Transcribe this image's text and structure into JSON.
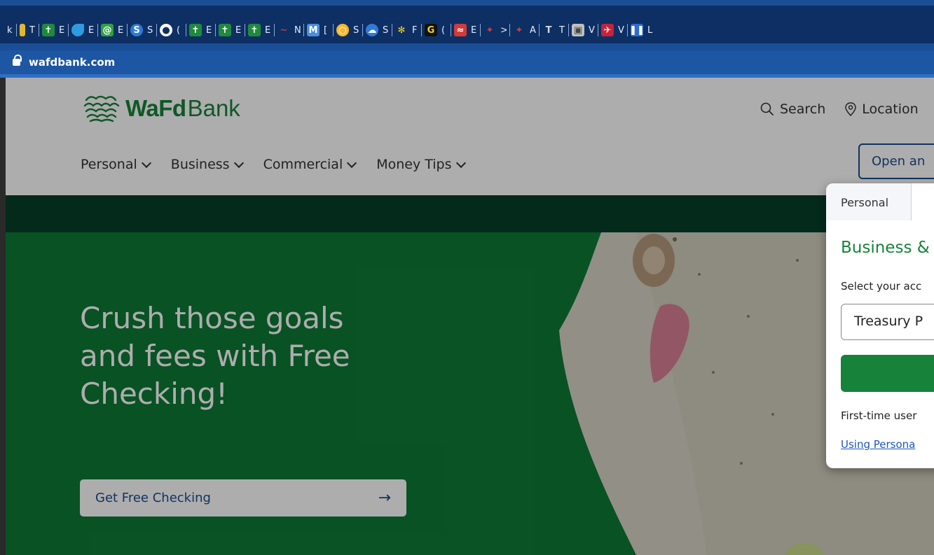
{
  "browser": {
    "tab_letters": [
      "k",
      "T",
      "E",
      "E",
      "E",
      "S",
      "(",
      "E",
      "E",
      "E",
      "N",
      "[",
      "S",
      "S",
      "F",
      "(",
      "E",
      ">",
      "A",
      "T",
      "V",
      "V",
      "L"
    ],
    "url": "wafdbank.com"
  },
  "header": {
    "logo_bold": "WaFd",
    "logo_regular": "Bank",
    "utility": {
      "search": "Search",
      "locations": "Location"
    },
    "nav": [
      {
        "label": "Personal"
      },
      {
        "label": "Business"
      },
      {
        "label": "Commercial"
      },
      {
        "label": "Money Tips"
      }
    ],
    "open_account": "Open an"
  },
  "hero": {
    "title": "Crush those goals and fees with Free Checking!",
    "cta": "Get Free Checking",
    "cta_arrow": "→"
  },
  "login_panel": {
    "tab_personal": "Personal",
    "heading": "Business &",
    "select_label": "Select your acc",
    "select_value": "Treasury P",
    "first_time": "First-time user",
    "link": "Using Persona"
  },
  "colors": {
    "brand_green": "#16823a",
    "navy": "#1b4b8c",
    "dark_band": "#063f2a"
  }
}
